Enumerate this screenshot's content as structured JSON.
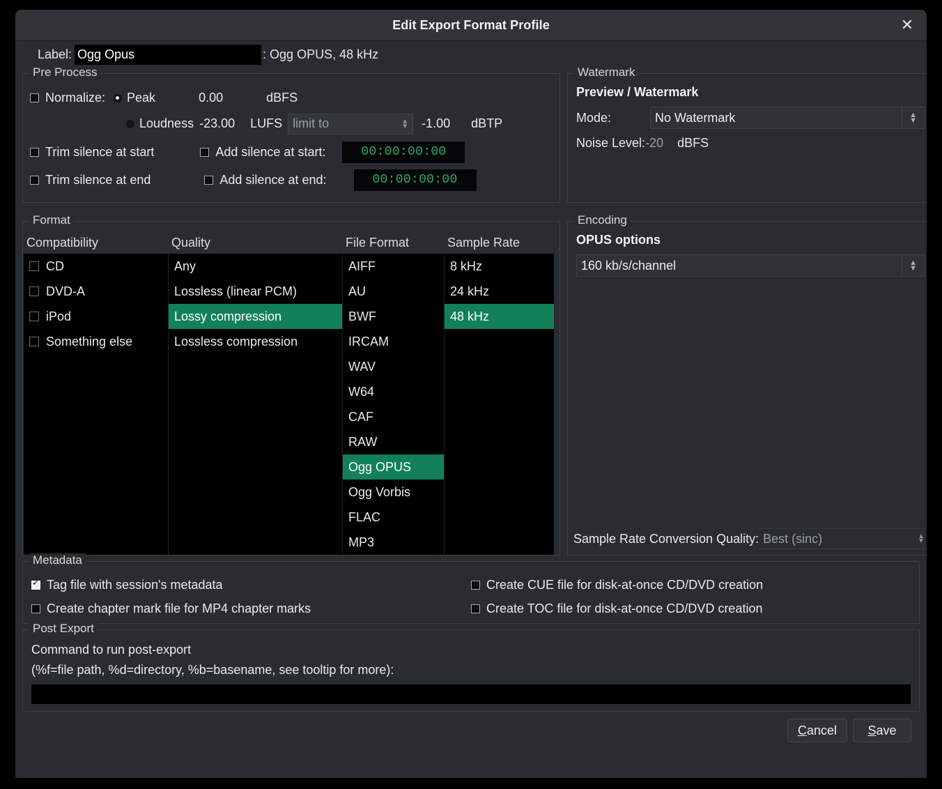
{
  "window": {
    "title": "Edit Export Format Profile",
    "close_icon": "close-icon"
  },
  "label_row": {
    "label": "Label:",
    "value": "Ogg Opus",
    "placeholder": "",
    "suffix": ": Ogg OPUS, 48 kHz"
  },
  "pre_process": {
    "legend": "Pre Process",
    "normalize_label": "Normalize:",
    "normalize_checked": false,
    "peak_label": "Peak",
    "peak_selected": true,
    "peak_value": "0.00",
    "peak_unit": "dBFS",
    "loudness_label": "Loudness",
    "loudness_selected": false,
    "loudness_value": "-23.00",
    "loudness_unit": "LUFS",
    "limit_to_placeholder": "limit to",
    "limit_to_value": "-1.00",
    "limit_to_unit": "dBTP",
    "trim_start_label": "Trim silence at start",
    "trim_start_checked": false,
    "trim_end_label": "Trim silence at end",
    "trim_end_checked": false,
    "add_start_label": "Add silence at start:",
    "add_start_checked": false,
    "add_start_time": "00:00:00:00",
    "add_end_label": "Add silence at end:",
    "add_end_checked": false,
    "add_end_time": "00:00:00:00"
  },
  "watermark": {
    "legend": "Watermark",
    "heading": "Preview / Watermark",
    "mode_label": "Mode:",
    "mode_value": "No Watermark",
    "noise_label": "Noise Level:",
    "noise_value": "-20",
    "noise_unit": "dBFS"
  },
  "format": {
    "legend": "Format",
    "columns": [
      {
        "header": "Compatibility",
        "type": "checkbox",
        "items": [
          {
            "label": "CD",
            "checked": false
          },
          {
            "label": "DVD-A",
            "checked": false
          },
          {
            "label": "iPod",
            "checked": false
          },
          {
            "label": "Something else",
            "checked": false
          }
        ]
      },
      {
        "header": "Quality",
        "type": "list",
        "items": [
          {
            "label": "Any",
            "selected": false
          },
          {
            "label": "Lossless (linear PCM)",
            "selected": false
          },
          {
            "label": "Lossy compression",
            "selected": true
          },
          {
            "label": "Lossless compression",
            "selected": false
          }
        ]
      },
      {
        "header": "File Format",
        "type": "list",
        "items": [
          {
            "label": "AIFF",
            "selected": false
          },
          {
            "label": "AU",
            "selected": false
          },
          {
            "label": "BWF",
            "selected": false
          },
          {
            "label": "IRCAM",
            "selected": false
          },
          {
            "label": "WAV",
            "selected": false
          },
          {
            "label": "W64",
            "selected": false
          },
          {
            "label": "CAF",
            "selected": false
          },
          {
            "label": "RAW",
            "selected": false
          },
          {
            "label": "Ogg OPUS",
            "selected": true
          },
          {
            "label": "Ogg Vorbis",
            "selected": false
          },
          {
            "label": "FLAC",
            "selected": false
          },
          {
            "label": "MP3",
            "selected": false
          }
        ]
      },
      {
        "header": "Sample Rate",
        "type": "list",
        "items": [
          {
            "label": "8 kHz",
            "selected": false
          },
          {
            "label": "24 kHz",
            "selected": false
          },
          {
            "label": "48 kHz",
            "selected": true
          }
        ]
      }
    ]
  },
  "encoding": {
    "legend": "Encoding",
    "heading": "OPUS options",
    "bitrate_value": "160 kb/s/channel",
    "srq_label": "Sample Rate Conversion Quality:",
    "srq_value": "Best (sinc)"
  },
  "metadata": {
    "legend": "Metadata",
    "left": [
      {
        "label": "Tag file with session's metadata",
        "checked": true
      },
      {
        "label": "Create chapter mark file for MP4 chapter marks",
        "checked": false
      }
    ],
    "right": [
      {
        "label": "Create CUE file for disk-at-once CD/DVD creation",
        "checked": false
      },
      {
        "label": "Create TOC file for disk-at-once CD/DVD creation",
        "checked": false
      }
    ]
  },
  "post_export": {
    "legend": "Post Export",
    "line1": "Command to run post-export",
    "line2": "(%f=file path, %d=directory, %b=basename, see tooltip for more):",
    "command_value": "",
    "command_placeholder": ""
  },
  "footer": {
    "cancel_mnemonic": "C",
    "cancel_rest": "ancel",
    "save_mnemonic": "S",
    "save_rest": "ave"
  },
  "colors": {
    "accent_green": "#128159",
    "timecode_green": "#2faa6e",
    "dialog_bg": "#292c30",
    "list_bg": "#000000"
  }
}
